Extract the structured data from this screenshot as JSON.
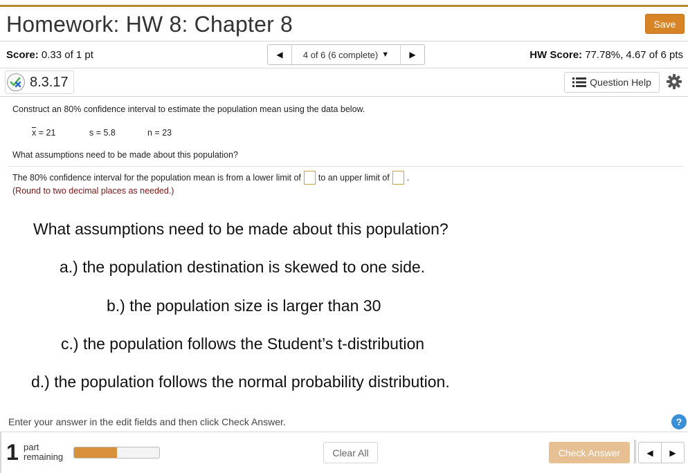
{
  "header": {
    "title": "Homework: HW 8: Chapter 8",
    "save_label": "Save"
  },
  "scorebar": {
    "score_label": "Score:",
    "score_value": "0.33 of 1 pt",
    "question_selector": "4 of 6 (6 complete)",
    "hw_score_label": "HW Score:",
    "hw_score_value": "77.78%, 4.67 of 6 pts"
  },
  "question": {
    "id": "8.3.17",
    "help_label": "Question Help",
    "prompt": "Construct an 80% confidence interval to estimate the population mean using the data below.",
    "stats": {
      "xbar_symbol": "x",
      "xbar_value": "= 21",
      "s": "s = 5.8",
      "n": "n = 23"
    },
    "assumption_question": "What assumptions need to be made about this population?",
    "answer_prefix": "The 80% confidence interval for the population mean is from a lower limit of",
    "answer_middle": "to an upper limit of",
    "answer_suffix": ".",
    "round_note": "(Round to two decimal places as needed.)"
  },
  "overlay": {
    "heading": "What assumptions need to be made about this population?",
    "option_a": "a.) the population destination is skewed to one side.",
    "option_b": "b.) the population size is larger than 30",
    "option_c": "c.) the population follows the Student’s t-distribution",
    "option_d": "d.) the population follows the normal probability distribution."
  },
  "footer": {
    "instruction": "Enter your answer in the edit fields and then click Check Answer.",
    "help_glyph": "?",
    "parts_count": "1",
    "parts_label_1": "part",
    "parts_label_2": "remaining",
    "progress_fraction": 0.5,
    "clear_label": "Clear All",
    "check_label": "Check Answer"
  },
  "colors": {
    "accent": "#d78427",
    "rule": "#b48a2c",
    "note": "#7a1515",
    "check_disabled": "#e6bf93"
  }
}
